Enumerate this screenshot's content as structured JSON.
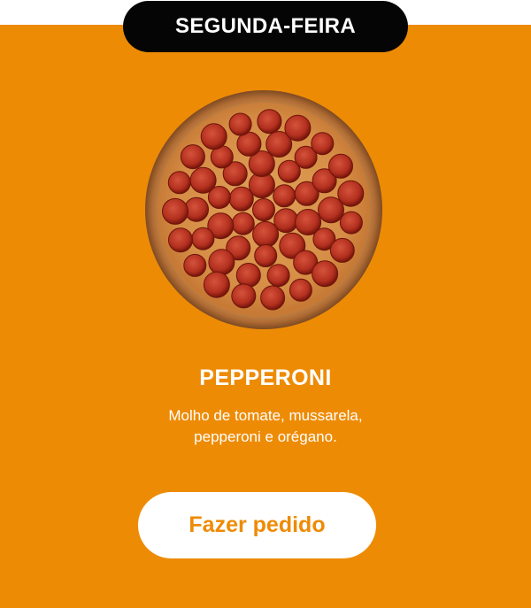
{
  "menu_card": {
    "day_label": "SEGUNDA-FEIRA",
    "pizza_image": "pepperoni-pizza-photo",
    "title": "PEPPERONI",
    "description_line1": "Molho de tomate, mussarela,",
    "description_line2": "pepperoni e orégano.",
    "order_button_label": "Fazer pedido"
  },
  "colors": {
    "card_background": "#EE8B05",
    "pill_background": "#050505",
    "button_background": "#FFFFFF",
    "button_text": "#EE8B05",
    "text": "#FFFFFF"
  }
}
